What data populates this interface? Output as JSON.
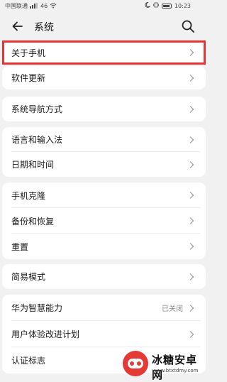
{
  "status_bar": {
    "carrier": "中国联通",
    "signal": "46",
    "time": "10:23"
  },
  "header": {
    "title": "系统"
  },
  "groups": [
    {
      "items": [
        {
          "label": "关于手机"
        }
      ]
    },
    {
      "items": [
        {
          "label": "软件更新"
        }
      ]
    },
    {
      "items": [
        {
          "label": "系统导航方式"
        }
      ]
    },
    {
      "items": [
        {
          "label": "语言和输入法"
        },
        {
          "label": "日期和时间"
        }
      ]
    },
    {
      "items": [
        {
          "label": "手机克隆"
        },
        {
          "label": "备份和恢复"
        },
        {
          "label": "重置"
        }
      ]
    },
    {
      "items": [
        {
          "label": "简易模式"
        }
      ]
    },
    {
      "items": [
        {
          "label": "华为智慧能力",
          "value": "已关闭"
        },
        {
          "label": "用户体验改进计划"
        },
        {
          "label": "认证标志"
        }
      ]
    }
  ],
  "watermark": {
    "title": "冰糖安卓网",
    "url": "www.btxtdmy.com"
  }
}
